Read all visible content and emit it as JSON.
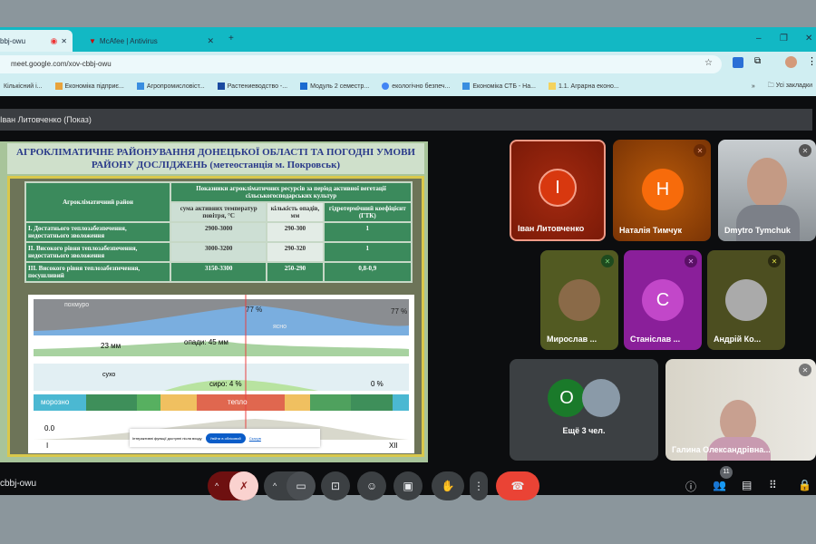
{
  "browser": {
    "tabs": [
      {
        "label": "cbbj-owu",
        "active": true
      },
      {
        "label": "McAfee | Antivirus"
      }
    ],
    "new_tab": "+",
    "window_buttons": [
      "–",
      "❐",
      "✕"
    ],
    "url": "meet.google.com/xov-cbbj-owu",
    "bookmarks": [
      "Кількісний і...",
      "Економіка підприє...",
      "Агропромисловіст...",
      "Растениеводство -...",
      "Модуль 2 семестр...",
      "екологічно безпеч...",
      "Економіка СТБ - На...",
      "1.1. Аграрна еконо..."
    ],
    "bookmarks_more": "»",
    "all_bookmarks": "Усі закладки"
  },
  "meet": {
    "presenter_title": "Іван Литовченко (Показ)",
    "meeting_code": "cbbj-owu",
    "participant_count": "11",
    "slide": {
      "title": "АГРОКЛІМАТИЧНЕ РАЙОНУВАННЯ ДОНЕЦЬКОЇ ОБЛАСТІ ТА ПОГОДНІ УМОВИ РАЙОНУ ДОСЛІДЖЕНЬ (метеостанція м. Покровськ)",
      "table": {
        "col_region": "Агрокліматичний район",
        "group_header": "Показники агрокліматичних ресурсів за період активної вегетації сільськогосподарських культур",
        "headers": [
          "сума активних температур повітря, °С",
          "кількість опадів, мм",
          "гідротермічний коефіцієнт (ГТК)"
        ],
        "rows": [
          [
            "І. Достатнього теплозабезпечення, недостатнього зволоження",
            "2900-3000",
            "290-300",
            "1"
          ],
          [
            "ІІ. Високого рівня теплозабезпечення, недостатнього зволоження",
            "3000-3200",
            "290-320",
            "1"
          ],
          [
            "ІІІ. Високого рівня теплозабезпечення, посушливий",
            "3150-3300",
            "250-290",
            "0,8-0,9"
          ]
        ]
      },
      "chart": {
        "cloud_label": "похмуро",
        "clear_label": "ясно",
        "cloud_peak": "77 %",
        "cloud_end": "77 %",
        "precip_start": "23 мм",
        "precip_peak": "опади: 45 мм",
        "dry_label": "сухо",
        "humid_peak": "сиро: 4 %",
        "humid_end": "0 %",
        "cold_label": "морозно",
        "warm_label": "тепло",
        "temp_start": "0.0",
        "month_start": "I",
        "month_end": "XII",
        "popup_text": "Інтерактивні функції доступні після входу",
        "popup_button": "Увійти в обліковий",
        "popup_link": "Скасув"
      }
    },
    "participants": [
      {
        "name": "Іван Литовченко",
        "initial": "І",
        "color": "#d8380f"
      },
      {
        "name": "Наталія Тимчук",
        "initial": "Н",
        "color": "#f76b0b"
      },
      {
        "name": "Dmytro Tymchuk"
      },
      {
        "name": "Мирослав ..."
      },
      {
        "name": "Станіслав ...",
        "initial": "С",
        "color": "#c247c9"
      },
      {
        "name": "Андрій Ко..."
      },
      {
        "name": "Галина Олександрівна..."
      }
    ],
    "others": {
      "label": "Ещё 3 чел.",
      "initial": "О"
    }
  }
}
